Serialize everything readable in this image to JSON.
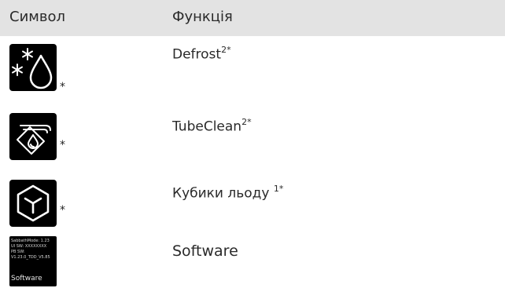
{
  "header": {
    "symbol_label": "Символ",
    "function_label": "Функція"
  },
  "rows": [
    {
      "icon": "defrost-icon",
      "asterisk": "*",
      "label": "Defrost",
      "superscript": "2*"
    },
    {
      "icon": "tubeclean-icon",
      "asterisk": "*",
      "label": "TubeClean",
      "superscript": "2*"
    },
    {
      "icon": "ice-cube-icon",
      "asterisk": "*",
      "label": "Кубики льоду ",
      "superscript": "1*"
    },
    {
      "icon": "software-screen-icon",
      "label": "Software",
      "screen": {
        "lines": [
          "SabbathMode: 1.23",
          "UI SW: XXXXXXXX",
          "PB SW:",
          "V1.23.0_TDD_V5.85"
        ],
        "title": "Software"
      }
    }
  ],
  "colors": {
    "header_background": "#e3e3e3",
    "icon_background": "#000000",
    "icon_foreground": "#ffffff",
    "text": "#2a2a2a"
  }
}
